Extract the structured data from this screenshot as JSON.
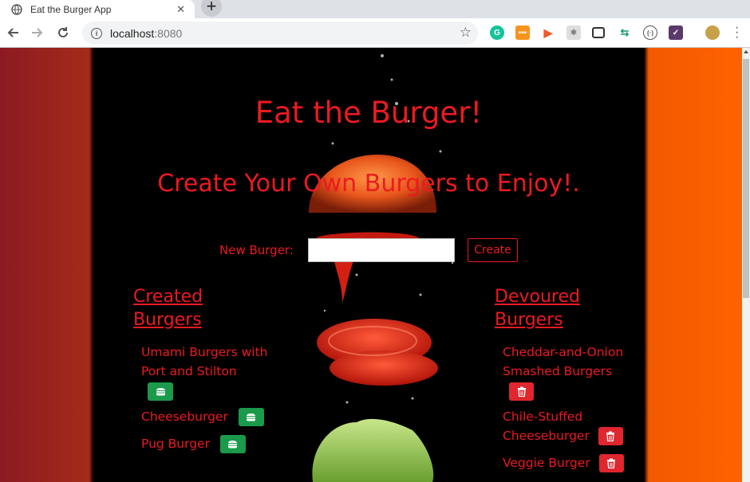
{
  "browser": {
    "tab_title": "Eat the Burger App",
    "tab_close": "✕",
    "new_tab": "+",
    "url_host": "localhost",
    "url_port": ":8080"
  },
  "page": {
    "title": "Eat the Burger!",
    "subtitle": "Create Your Own Burgers to Enjoy!.",
    "form": {
      "label": "New Burger:",
      "input_value": "",
      "create_label": "Create"
    },
    "created": {
      "heading_line1": "Created",
      "heading_line2": "Burgers",
      "items": [
        {
          "line1": "Umami Burgers with",
          "line2": "Port and Stilton"
        },
        {
          "line1": "Cheeseburger"
        },
        {
          "line1": "Pug Burger"
        }
      ]
    },
    "devoured": {
      "heading_line1": "Devoured",
      "heading_line2": "Burgers",
      "items": [
        {
          "line1": "Cheddar-and-Onion",
          "line2": "Smashed Burgers"
        },
        {
          "line1": "Chile-Stuffed",
          "line2": "Cheeseburger"
        },
        {
          "line1": "Veggie Burger"
        }
      ]
    }
  },
  "colors": {
    "text_red": "#ec1a20",
    "eat_button_green": "#1a9a4a",
    "delete_button_red": "#e0262f"
  }
}
